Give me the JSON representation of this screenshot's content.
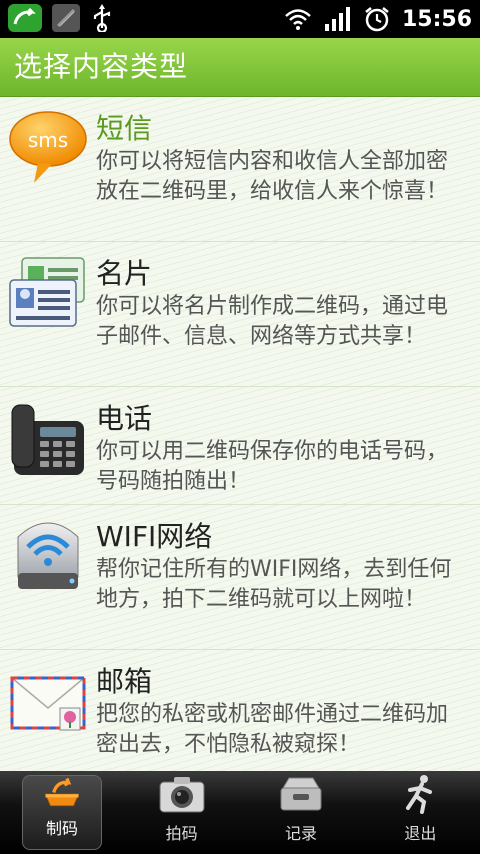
{
  "status": {
    "time": "15:56"
  },
  "header": {
    "title": "选择内容类型"
  },
  "items": [
    {
      "icon": "sms-bubble-icon",
      "icon_label": "sms",
      "name": "短信",
      "desc": "你可以将短信内容和收信人全部加密放在二维码里，给收信人来个惊喜！"
    },
    {
      "icon": "business-card-icon",
      "name": "名片",
      "desc": "你可以将名片制作成二维码，通过电子邮件、信息、网络等方式共享！"
    },
    {
      "icon": "telephone-icon",
      "name": "电话",
      "desc": "你可以用二维码保存你的电话号码，号码随拍随出！"
    },
    {
      "icon": "wifi-drive-icon",
      "name": "WIFI网络",
      "desc": "帮你记住所有的WIFI网络，去到任何地方，拍下二维码就可以上网啦！"
    },
    {
      "icon": "envelope-icon",
      "name": "邮箱",
      "desc": "把您的私密或机密邮件通过二维码加密出去，不怕隐私被窥探！"
    }
  ],
  "tabs": [
    {
      "label": "制码",
      "icon": "make-code-icon",
      "active": true
    },
    {
      "label": "拍码",
      "icon": "camera-icon",
      "active": false
    },
    {
      "label": "记录",
      "icon": "records-tray-icon",
      "active": false
    },
    {
      "label": "退出",
      "icon": "exit-runner-icon",
      "active": false
    }
  ],
  "colors": {
    "accent": "#7cc038",
    "title_text": "#ffffff",
    "first_item_name": "#5a9a21"
  }
}
